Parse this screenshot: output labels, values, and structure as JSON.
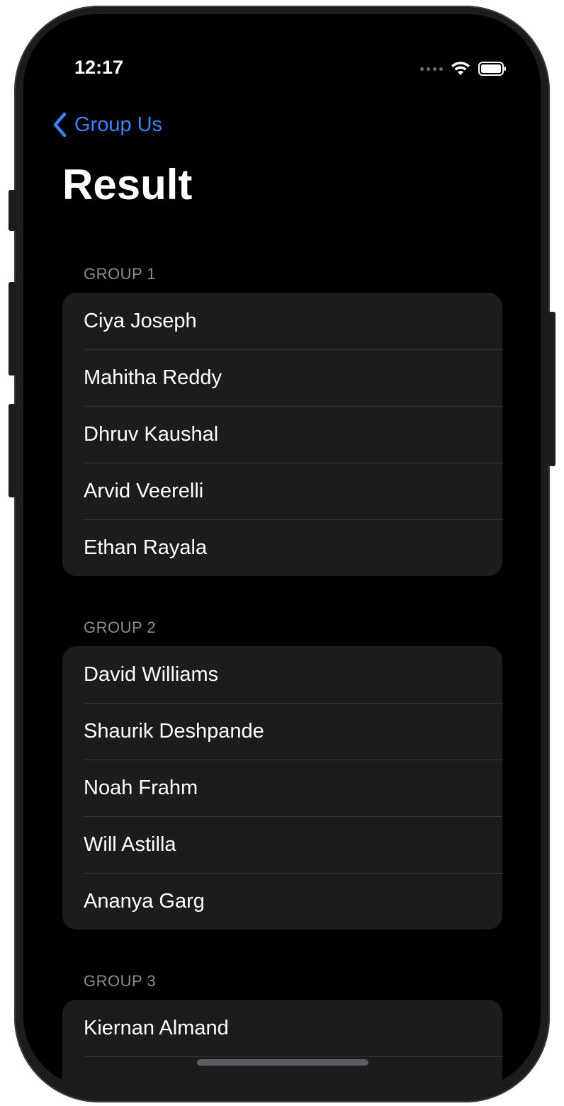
{
  "status_bar": {
    "time": "12:17"
  },
  "nav": {
    "back_label": "Group Us"
  },
  "page": {
    "title": "Result"
  },
  "groups": [
    {
      "header": "GROUP 1",
      "members": [
        "Ciya Joseph",
        "Mahitha Reddy",
        "Dhruv Kaushal",
        "Arvid Veerelli",
        "Ethan Rayala"
      ]
    },
    {
      "header": "GROUP 2",
      "members": [
        "David Williams",
        "Shaurik Deshpande",
        "Noah Frahm",
        "Will Astilla",
        "Ananya Garg"
      ]
    },
    {
      "header": "GROUP 3",
      "members": [
        "Kiernan Almand"
      ]
    }
  ],
  "colors": {
    "accent": "#3a82f7",
    "background": "#000000",
    "card": "#1c1c1e",
    "separator": "#38383a",
    "section_text": "#8d8d93"
  },
  "icons": {
    "back": "chevron-left-icon",
    "signal": "cellular-signal-icon",
    "wifi": "wifi-icon",
    "battery": "battery-icon"
  }
}
